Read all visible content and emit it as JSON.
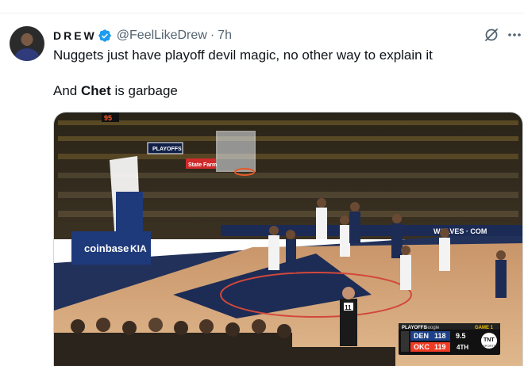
{
  "post": {
    "display_name": "DREW",
    "handle": "@FeelLikeDrew",
    "separator": "·",
    "time": "7h",
    "line1": "Nuggets just have playoff devil magic, no other way to explain it",
    "line2_prefix": "And ",
    "line2_bold": "Chet",
    "line2_suffix": " is garbage"
  },
  "video": {
    "shot_clock": "95",
    "sponsor_left": "coinbase",
    "sponsor_kia": "KIA",
    "sponsor_state_farm": "State Farm",
    "playoffs_board": "PLAYOFFS",
    "court_text": "WOLVES · COM",
    "player_number": "11",
    "score": {
      "header": "PLAYOFFS",
      "sponsor": "Google",
      "game": "GAME 1",
      "team1": "DEN",
      "score1": "118",
      "team2": "OKC",
      "score2": "119",
      "clock": "9.5",
      "period": "4TH",
      "network": "TNT",
      "network_sub": "SPORTS"
    }
  },
  "colors": {
    "accent_blue": "#1d9bf0",
    "text_primary": "#0f1419",
    "text_secondary": "#536471",
    "okc_orange": "#ef3b24"
  },
  "icons": {
    "verified": "verified-badge-icon",
    "grok": "grok-icon",
    "more": "more-icon"
  }
}
